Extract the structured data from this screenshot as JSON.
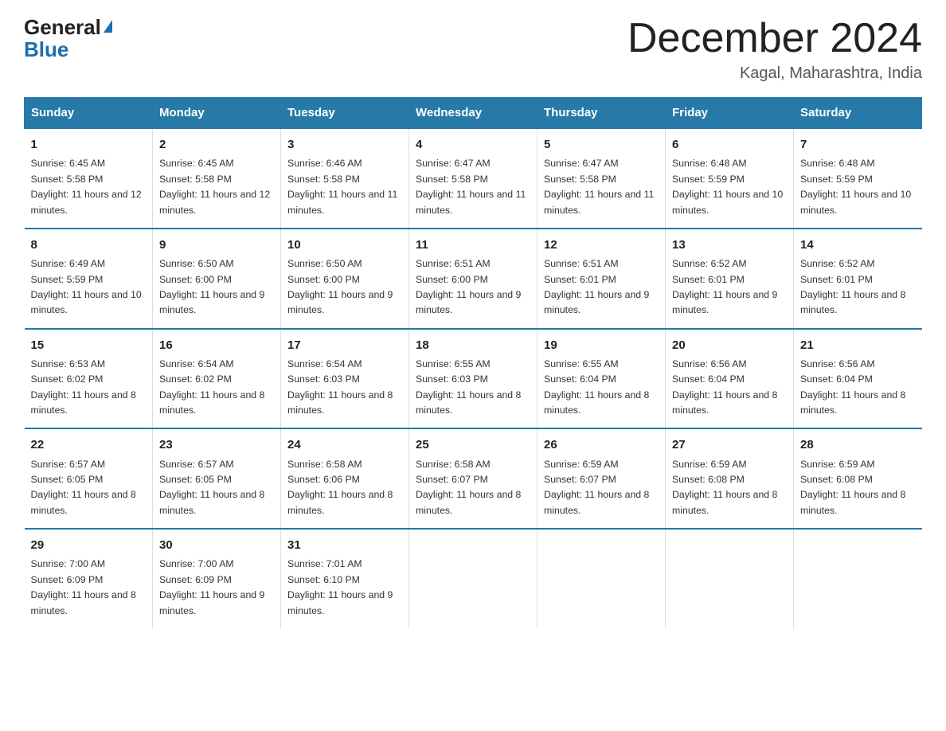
{
  "header": {
    "logo_line1": "General",
    "logo_line2": "Blue",
    "month_title": "December 2024",
    "location": "Kagal, Maharashtra, India"
  },
  "days_of_week": [
    "Sunday",
    "Monday",
    "Tuesday",
    "Wednesday",
    "Thursday",
    "Friday",
    "Saturday"
  ],
  "weeks": [
    [
      {
        "day": "1",
        "sunrise": "6:45 AM",
        "sunset": "5:58 PM",
        "daylight": "11 hours and 12 minutes."
      },
      {
        "day": "2",
        "sunrise": "6:45 AM",
        "sunset": "5:58 PM",
        "daylight": "11 hours and 12 minutes."
      },
      {
        "day": "3",
        "sunrise": "6:46 AM",
        "sunset": "5:58 PM",
        "daylight": "11 hours and 11 minutes."
      },
      {
        "day": "4",
        "sunrise": "6:47 AM",
        "sunset": "5:58 PM",
        "daylight": "11 hours and 11 minutes."
      },
      {
        "day": "5",
        "sunrise": "6:47 AM",
        "sunset": "5:58 PM",
        "daylight": "11 hours and 11 minutes."
      },
      {
        "day": "6",
        "sunrise": "6:48 AM",
        "sunset": "5:59 PM",
        "daylight": "11 hours and 10 minutes."
      },
      {
        "day": "7",
        "sunrise": "6:48 AM",
        "sunset": "5:59 PM",
        "daylight": "11 hours and 10 minutes."
      }
    ],
    [
      {
        "day": "8",
        "sunrise": "6:49 AM",
        "sunset": "5:59 PM",
        "daylight": "11 hours and 10 minutes."
      },
      {
        "day": "9",
        "sunrise": "6:50 AM",
        "sunset": "6:00 PM",
        "daylight": "11 hours and 9 minutes."
      },
      {
        "day": "10",
        "sunrise": "6:50 AM",
        "sunset": "6:00 PM",
        "daylight": "11 hours and 9 minutes."
      },
      {
        "day": "11",
        "sunrise": "6:51 AM",
        "sunset": "6:00 PM",
        "daylight": "11 hours and 9 minutes."
      },
      {
        "day": "12",
        "sunrise": "6:51 AM",
        "sunset": "6:01 PM",
        "daylight": "11 hours and 9 minutes."
      },
      {
        "day": "13",
        "sunrise": "6:52 AM",
        "sunset": "6:01 PM",
        "daylight": "11 hours and 9 minutes."
      },
      {
        "day": "14",
        "sunrise": "6:52 AM",
        "sunset": "6:01 PM",
        "daylight": "11 hours and 8 minutes."
      }
    ],
    [
      {
        "day": "15",
        "sunrise": "6:53 AM",
        "sunset": "6:02 PM",
        "daylight": "11 hours and 8 minutes."
      },
      {
        "day": "16",
        "sunrise": "6:54 AM",
        "sunset": "6:02 PM",
        "daylight": "11 hours and 8 minutes."
      },
      {
        "day": "17",
        "sunrise": "6:54 AM",
        "sunset": "6:03 PM",
        "daylight": "11 hours and 8 minutes."
      },
      {
        "day": "18",
        "sunrise": "6:55 AM",
        "sunset": "6:03 PM",
        "daylight": "11 hours and 8 minutes."
      },
      {
        "day": "19",
        "sunrise": "6:55 AM",
        "sunset": "6:04 PM",
        "daylight": "11 hours and 8 minutes."
      },
      {
        "day": "20",
        "sunrise": "6:56 AM",
        "sunset": "6:04 PM",
        "daylight": "11 hours and 8 minutes."
      },
      {
        "day": "21",
        "sunrise": "6:56 AM",
        "sunset": "6:04 PM",
        "daylight": "11 hours and 8 minutes."
      }
    ],
    [
      {
        "day": "22",
        "sunrise": "6:57 AM",
        "sunset": "6:05 PM",
        "daylight": "11 hours and 8 minutes."
      },
      {
        "day": "23",
        "sunrise": "6:57 AM",
        "sunset": "6:05 PM",
        "daylight": "11 hours and 8 minutes."
      },
      {
        "day": "24",
        "sunrise": "6:58 AM",
        "sunset": "6:06 PM",
        "daylight": "11 hours and 8 minutes."
      },
      {
        "day": "25",
        "sunrise": "6:58 AM",
        "sunset": "6:07 PM",
        "daylight": "11 hours and 8 minutes."
      },
      {
        "day": "26",
        "sunrise": "6:59 AM",
        "sunset": "6:07 PM",
        "daylight": "11 hours and 8 minutes."
      },
      {
        "day": "27",
        "sunrise": "6:59 AM",
        "sunset": "6:08 PM",
        "daylight": "11 hours and 8 minutes."
      },
      {
        "day": "28",
        "sunrise": "6:59 AM",
        "sunset": "6:08 PM",
        "daylight": "11 hours and 8 minutes."
      }
    ],
    [
      {
        "day": "29",
        "sunrise": "7:00 AM",
        "sunset": "6:09 PM",
        "daylight": "11 hours and 8 minutes."
      },
      {
        "day": "30",
        "sunrise": "7:00 AM",
        "sunset": "6:09 PM",
        "daylight": "11 hours and 9 minutes."
      },
      {
        "day": "31",
        "sunrise": "7:01 AM",
        "sunset": "6:10 PM",
        "daylight": "11 hours and 9 minutes."
      },
      null,
      null,
      null,
      null
    ]
  ]
}
